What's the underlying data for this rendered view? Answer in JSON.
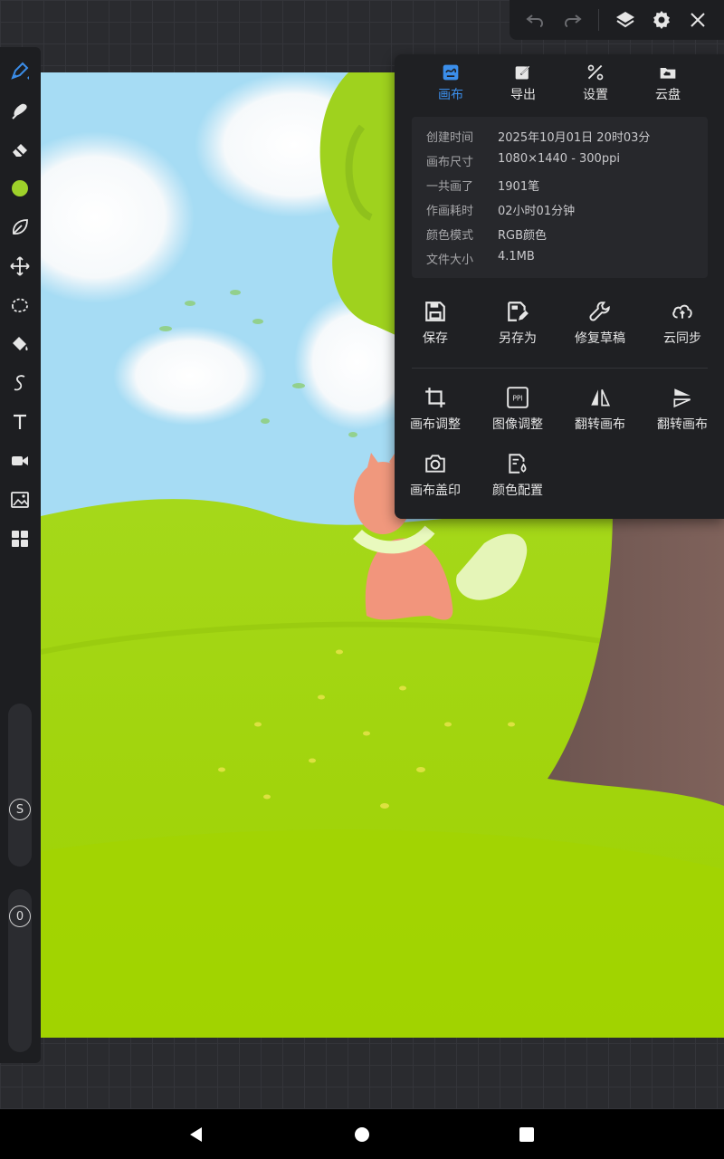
{
  "tabs": [
    {
      "label": "画布",
      "icon": "canvas-icon",
      "active": true
    },
    {
      "label": "导出",
      "icon": "export-icon",
      "active": false
    },
    {
      "label": "设置",
      "icon": "settings-tools-icon",
      "active": false
    },
    {
      "label": "云盘",
      "icon": "cloud-drive-icon",
      "active": false
    }
  ],
  "info": [
    {
      "key": "创建时间",
      "value": "2025年10月01日 20时03分"
    },
    {
      "key": "画布尺寸",
      "value": "1080×1440 - 300ppi"
    },
    {
      "key": "一共画了",
      "value": "1901笔"
    },
    {
      "key": "作画耗时",
      "value": "02小时01分钟"
    },
    {
      "key": "颜色模式",
      "value": "RGB颜色"
    },
    {
      "key": "文件大小",
      "value": "4.1MB"
    }
  ],
  "actions": [
    {
      "label": "保存",
      "icon": "save-icon"
    },
    {
      "label": "另存为",
      "icon": "save-as-icon"
    },
    {
      "label": "修复草稿",
      "icon": "wrench-icon"
    },
    {
      "label": "云同步",
      "icon": "cloud-sync-icon"
    },
    {
      "label": "画布调整",
      "icon": "crop-icon"
    },
    {
      "label": "图像调整",
      "icon": "ppi-icon"
    },
    {
      "label": "翻转画布",
      "icon": "flip-horizontal-icon"
    },
    {
      "label": "翻转画布",
      "icon": "flip-vertical-icon"
    },
    {
      "label": "画布盖印",
      "icon": "camera-stamp-icon"
    },
    {
      "label": "颜色配置",
      "icon": "color-config-icon"
    }
  ],
  "sliders": {
    "size_label": "S",
    "opacity_label": "0"
  },
  "colors": {
    "accent": "#3b8eea",
    "current_color": "#9ed12a",
    "panel": "#1f2023"
  }
}
